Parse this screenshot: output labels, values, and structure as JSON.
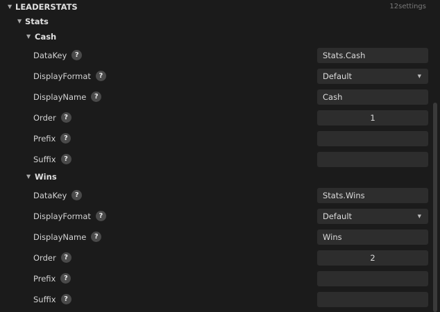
{
  "root": {
    "label": "LEADERSTATS",
    "count": "12settings"
  },
  "stats": {
    "label": "Stats"
  },
  "groups": [
    {
      "label": "Cash",
      "props": {
        "datakey": {
          "label": "DataKey",
          "value": "Stats.Cash"
        },
        "displayformat": {
          "label": "DisplayFormat",
          "value": "Default"
        },
        "displayname": {
          "label": "DisplayName",
          "value": "Cash"
        },
        "order": {
          "label": "Order",
          "value": "1"
        },
        "prefix": {
          "label": "Prefix",
          "value": ""
        },
        "suffix": {
          "label": "Suffix",
          "value": ""
        }
      }
    },
    {
      "label": "Wins",
      "props": {
        "datakey": {
          "label": "DataKey",
          "value": "Stats.Wins"
        },
        "displayformat": {
          "label": "DisplayFormat",
          "value": "Default"
        },
        "displayname": {
          "label": "DisplayName",
          "value": "Wins"
        },
        "order": {
          "label": "Order",
          "value": "2"
        },
        "prefix": {
          "label": "Prefix",
          "value": ""
        },
        "suffix": {
          "label": "Suffix",
          "value": ""
        }
      }
    }
  ],
  "icons": {
    "expanded": "caret-down-icon",
    "help": "question-mark-icon",
    "dropdown": "dropdown-arrow-icon"
  }
}
